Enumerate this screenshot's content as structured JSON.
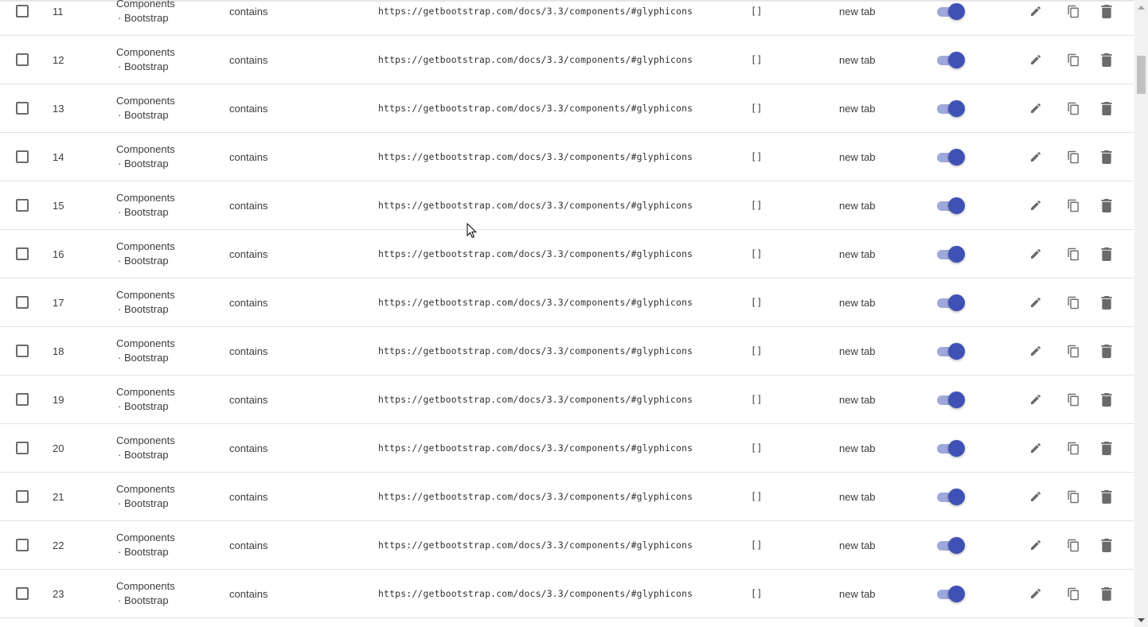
{
  "rows": [
    {
      "id": "11",
      "name_line1": "Components",
      "name_line2": "· Bootstrap",
      "match": "contains",
      "url": "https://getbootstrap.com/docs/3.3/components/#glyphicons",
      "tags": "[]",
      "open": "new tab",
      "enabled": true
    },
    {
      "id": "12",
      "name_line1": "Components",
      "name_line2": "· Bootstrap",
      "match": "contains",
      "url": "https://getbootstrap.com/docs/3.3/components/#glyphicons",
      "tags": "[]",
      "open": "new tab",
      "enabled": true
    },
    {
      "id": "13",
      "name_line1": "Components",
      "name_line2": "· Bootstrap",
      "match": "contains",
      "url": "https://getbootstrap.com/docs/3.3/components/#glyphicons",
      "tags": "[]",
      "open": "new tab",
      "enabled": true
    },
    {
      "id": "14",
      "name_line1": "Components",
      "name_line2": "· Bootstrap",
      "match": "contains",
      "url": "https://getbootstrap.com/docs/3.3/components/#glyphicons",
      "tags": "[]",
      "open": "new tab",
      "enabled": true
    },
    {
      "id": "15",
      "name_line1": "Components",
      "name_line2": "· Bootstrap",
      "match": "contains",
      "url": "https://getbootstrap.com/docs/3.3/components/#glyphicons",
      "tags": "[]",
      "open": "new tab",
      "enabled": true
    },
    {
      "id": "16",
      "name_line1": "Components",
      "name_line2": "· Bootstrap",
      "match": "contains",
      "url": "https://getbootstrap.com/docs/3.3/components/#glyphicons",
      "tags": "[]",
      "open": "new tab",
      "enabled": true
    },
    {
      "id": "17",
      "name_line1": "Components",
      "name_line2": "· Bootstrap",
      "match": "contains",
      "url": "https://getbootstrap.com/docs/3.3/components/#glyphicons",
      "tags": "[]",
      "open": "new tab",
      "enabled": true
    },
    {
      "id": "18",
      "name_line1": "Components",
      "name_line2": "· Bootstrap",
      "match": "contains",
      "url": "https://getbootstrap.com/docs/3.3/components/#glyphicons",
      "tags": "[]",
      "open": "new tab",
      "enabled": true
    },
    {
      "id": "19",
      "name_line1": "Components",
      "name_line2": "· Bootstrap",
      "match": "contains",
      "url": "https://getbootstrap.com/docs/3.3/components/#glyphicons",
      "tags": "[]",
      "open": "new tab",
      "enabled": true
    },
    {
      "id": "20",
      "name_line1": "Components",
      "name_line2": "· Bootstrap",
      "match": "contains",
      "url": "https://getbootstrap.com/docs/3.3/components/#glyphicons",
      "tags": "[]",
      "open": "new tab",
      "enabled": true
    },
    {
      "id": "21",
      "name_line1": "Components",
      "name_line2": "· Bootstrap",
      "match": "contains",
      "url": "https://getbootstrap.com/docs/3.3/components/#glyphicons",
      "tags": "[]",
      "open": "new tab",
      "enabled": true
    },
    {
      "id": "22",
      "name_line1": "Components",
      "name_line2": "· Bootstrap",
      "match": "contains",
      "url": "https://getbootstrap.com/docs/3.3/components/#glyphicons",
      "tags": "[]",
      "open": "new tab",
      "enabled": true
    },
    {
      "id": "23",
      "name_line1": "Components",
      "name_line2": "· Bootstrap",
      "match": "contains",
      "url": "https://getbootstrap.com/docs/3.3/components/#glyphicons",
      "tags": "[]",
      "open": "new tab",
      "enabled": true
    }
  ],
  "icons": {
    "checkbox": "checkbox-unchecked",
    "toggle": "toggle-switch",
    "edit": "pencil-icon",
    "copy": "copy-icon",
    "delete": "trash-icon",
    "scroll_up": "scroll-up-arrow-icon",
    "scroll_down": "scroll-down-arrow-icon",
    "cursor": "mouse-pointer-icon"
  },
  "colors": {
    "toggle_knob": "#3f51b5",
    "toggle_track": "#9fa8da",
    "icon": "#6b6b6b",
    "row_divider": "#e3e3e3"
  }
}
